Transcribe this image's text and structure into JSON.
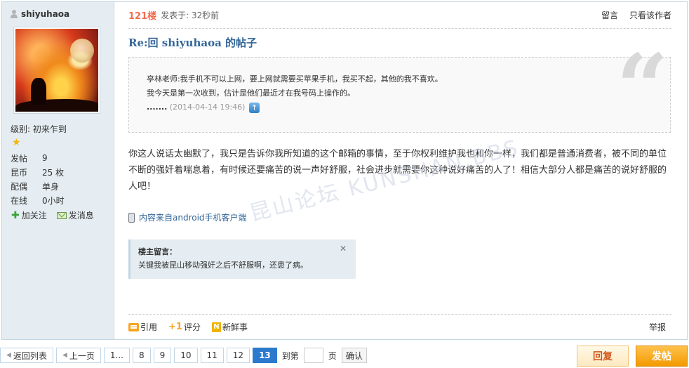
{
  "author": {
    "username": "shiyuhaoa",
    "level_label": "级别: 初来乍到",
    "stats": [
      {
        "key": "发帖",
        "value": "9"
      },
      {
        "key": "昆币",
        "value": "25 枚"
      },
      {
        "key": "配偶",
        "value": "单身"
      },
      {
        "key": "在线",
        "value": "0小时"
      }
    ],
    "follow_label": "加关注",
    "message_label": "发消息"
  },
  "post": {
    "floor": "121楼",
    "posted_time": "发表于: 32秒前",
    "leave_comment": "留言",
    "only_author": "只看该作者",
    "title": "Re:回  shiyuhaoa 的帖子",
    "quote": {
      "line1": "亭林老师:我手机不可以上网，要上网就需要买苹果手机，我买不起，其他的我不喜欢。",
      "line2": "我今天是第一次收到，估计是他们最近才在我号码上操作的。",
      "dots": ".......",
      "time": "(2014-04-14 19:46)"
    },
    "body": "你这人说话太幽默了，我只是告诉你我所知道的这个邮箱的事情，至于你权利维护我也和你一样，我们都是普通消费者，被不同的单位不断的强奸着喘息着，有时候还要痛苦的说一声好舒服，社会进步就需要你这种说好痛苦的人了！相信大部分人都是痛苦的说好舒服的人吧！",
    "device": "内容来自android手机客户端",
    "owner_note": {
      "title": "楼主留言：",
      "text": "关键我被昆山移动强奸之后不舒服啊，还患了病。"
    },
    "actions": {
      "quote": "引用",
      "rate": "评分",
      "fresh": "新鲜事",
      "report": "举报"
    }
  },
  "pager": {
    "back": "返回列表",
    "prev": "上一页",
    "ellipsis": "1...",
    "pages": [
      "8",
      "9",
      "10",
      "11",
      "12",
      "13"
    ],
    "current": "13",
    "goto": "到第",
    "page_unit": "页",
    "confirm": "确认"
  },
  "buttons": {
    "reply": "回复",
    "post": "发帖"
  },
  "watermark": "昆山论坛 KUNSHAN.BBS",
  "colors": {
    "accent": "#336699",
    "floor": "#f26c4f",
    "post_button": "#f39a00",
    "current_page": "#2b7acd"
  }
}
